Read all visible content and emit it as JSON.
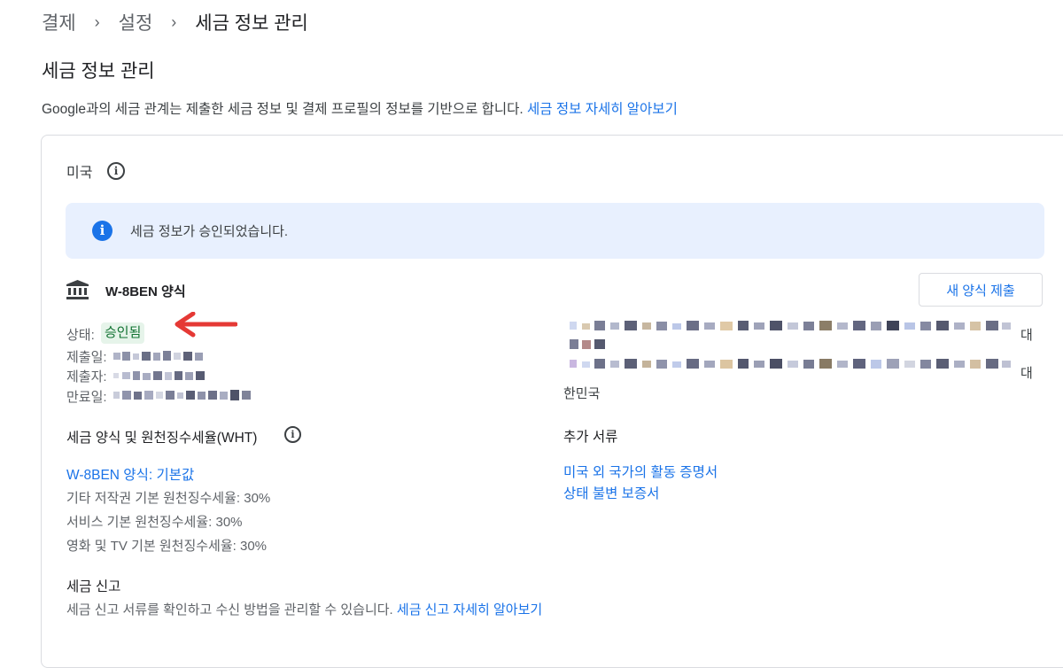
{
  "breadcrumb": {
    "items": [
      "결제",
      "설정",
      "세금 정보 관리"
    ]
  },
  "page": {
    "title": "세금 정보 관리",
    "intro": "Google과의 세금 관계는 제출한 세금 정보 및 결제 프로필의 정보를 기반으로 합니다.",
    "intro_link": "세금 정보 자세히 알아보기"
  },
  "card": {
    "country": "미국",
    "banner_text": "세금 정보가 승인되었습니다.",
    "form_title": "W-8BEN 양식",
    "new_form_button": "새 양식 제출",
    "status_label": "상태:",
    "status_value": "승인됨",
    "submitted_label": "제출일:",
    "submitter_label": "제출자:",
    "expiry_label": "만료일:",
    "address_suffix_1": "대",
    "address_suffix_2": "대",
    "address_country": "한민국",
    "wht_title": "세금 양식 및 원천징수세율(WHT)",
    "wht_link": "W-8BEN 양식: 기본값",
    "rates": [
      "기타 저작권 기본 원천징수세율: 30%",
      "서비스 기본 원천징수세율: 30%",
      "영화 및 TV 기본 원천징수세율: 30%"
    ],
    "extra_docs_title": "추가 서류",
    "extra_docs_links": [
      "미국 외 국가의 활동 증명서",
      "상태 불변 보증서"
    ],
    "tax_report_title": "세금 신고",
    "tax_report_desc": "세금 신고 서류를 확인하고 수신 방법을 관리할 수 있습니다.",
    "tax_report_link": "세금 신고 자세히 알아보기"
  },
  "colors": {
    "link": "#1a73e8",
    "banner_bg": "#e8f0fe",
    "status_chip_bg": "#e6f4ea",
    "status_chip_text": "#137333",
    "annotation_arrow": "#e53935"
  }
}
